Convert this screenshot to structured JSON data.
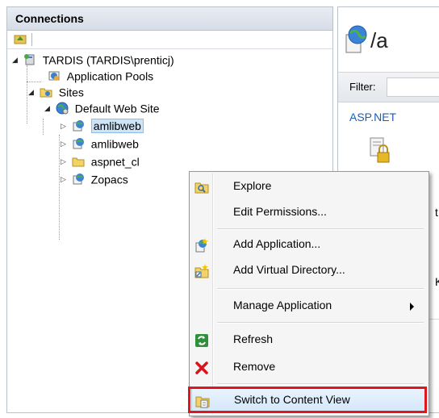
{
  "connections": {
    "header": "Connections",
    "tree": {
      "server": "TARDIS (TARDIS\\prenticj)",
      "app_pools": "Application Pools",
      "sites": "Sites",
      "default_site": "Default Web Site",
      "children": [
        "amlibweb",
        "amlibweb",
        "aspnet_cl",
        "Zopacs"
      ]
    }
  },
  "content": {
    "title": "/a",
    "filter_label": "Filter:",
    "group_label": "ASP.NET",
    "fragment_1": "t.",
    "fragment_2": "Ke"
  },
  "context_menu": {
    "items": [
      {
        "label": "Explore",
        "icon": "explore-icon"
      },
      {
        "label": "Edit Permissions...",
        "icon": ""
      },
      {
        "label": "Add Application...",
        "icon": "add-application-icon"
      },
      {
        "label": "Add Virtual Directory...",
        "icon": "add-virtual-directory-icon"
      },
      {
        "label": "Manage Application",
        "icon": "",
        "submenu": true
      },
      {
        "label": "Refresh",
        "icon": "refresh-icon"
      },
      {
        "label": "Remove",
        "icon": "remove-icon"
      },
      {
        "label": "Switch to Content View",
        "icon": "content-view-icon"
      }
    ]
  },
  "colors": {
    "highlight_border": "#e0161f",
    "selection": "#cde3f6",
    "link": "#1b5fb2"
  }
}
